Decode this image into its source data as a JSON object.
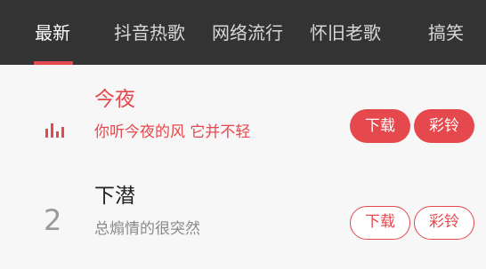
{
  "tabs": [
    {
      "label": "最新",
      "active": true
    },
    {
      "label": "抖音热歌",
      "active": false
    },
    {
      "label": "网络流行",
      "active": false
    },
    {
      "label": "怀旧老歌",
      "active": false
    },
    {
      "label": "搞笑",
      "active": false
    }
  ],
  "songs": [
    {
      "rank": "1",
      "rank_icon": "playing-bars-icon",
      "title": "今夜",
      "artist": "你听今夜的风 它并不轻",
      "download_label": "下载",
      "ringtone_label": "彩铃",
      "highlighted": true
    },
    {
      "rank": "2",
      "title": "下潜",
      "artist": "总煽情的很突然",
      "download_label": "下载",
      "ringtone_label": "彩铃",
      "highlighted": false
    }
  ],
  "colors": {
    "accent": "#e5484d",
    "tabbar_bg": "#333333",
    "page_bg": "#f7f7f7"
  }
}
